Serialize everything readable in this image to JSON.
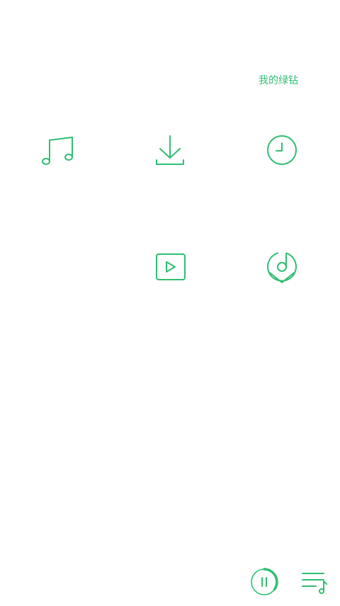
{
  "header": {
    "vip_link": "我的绿钻"
  },
  "grid": {
    "items": [
      {
        "icon": "music-note-icon"
      },
      {
        "icon": "download-icon"
      },
      {
        "icon": "clock-icon"
      },
      {
        "icon": "play-video-icon"
      },
      {
        "icon": "music-location-icon"
      }
    ]
  },
  "player_bar": {
    "play_state": "playing",
    "progress": 0.4,
    "icons": [
      "pause-icon",
      "playlist-icon"
    ]
  },
  "colors": {
    "accent": "#2fbf71",
    "background": "#ffffff"
  }
}
